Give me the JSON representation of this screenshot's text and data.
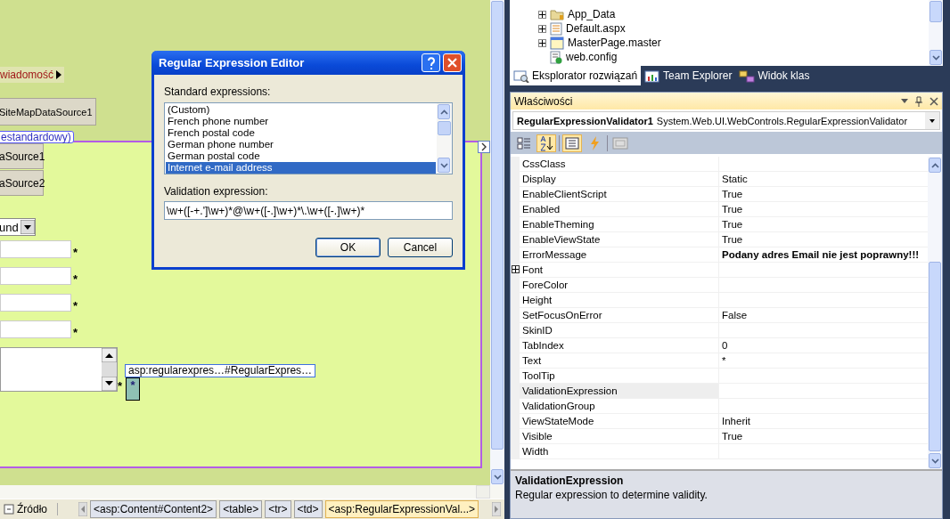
{
  "designer": {
    "menu_label": "wiadomość",
    "top_datasource": "SiteMapDataSource1",
    "content_tag": "estandardowy)",
    "datasources": [
      "aSource1",
      "aSource2"
    ],
    "dropdown_value": "und",
    "field_rows": [
      {
        "required_mark": "*"
      },
      {
        "required_mark": "*"
      },
      {
        "required_mark": "*"
      },
      {
        "required_mark": "*"
      }
    ],
    "textarea_mark": "*",
    "validator_text": "*",
    "smart_tag": "asp:regularexpres…#RegularExpres…"
  },
  "dialog": {
    "title": "Regular Expression Editor",
    "standard_label": "Standard expressions:",
    "options": [
      {
        "label": "(Custom)",
        "selected": false
      },
      {
        "label": "French phone number",
        "selected": false
      },
      {
        "label": "French postal code",
        "selected": false
      },
      {
        "label": "German phone number",
        "selected": false
      },
      {
        "label": "German postal code",
        "selected": false
      },
      {
        "label": "Internet e-mail address",
        "selected": true
      }
    ],
    "expression_label": "Validation expression:",
    "expression": "\\w+([-+.']\\w+)*@\\w+([-.]\\w+)*\\.\\w+([-.]\\w+)*",
    "buttons": [
      "OK",
      "Cancel"
    ]
  },
  "solution_tree": [
    {
      "label": "App_Data",
      "kind": "folder",
      "expandable": true
    },
    {
      "label": "Default.aspx",
      "kind": "page",
      "expandable": true
    },
    {
      "label": "MasterPage.master",
      "kind": "master",
      "expandable": true
    },
    {
      "label": "web.config",
      "kind": "config",
      "expandable": false
    }
  ],
  "tabs": [
    {
      "label": "Eksplorator rozwiązań",
      "selected": true
    },
    {
      "label": "Team Explorer",
      "selected": false
    },
    {
      "label": "Widok klas",
      "selected": false
    }
  ],
  "properties": {
    "title": "Właściwości",
    "object_name": "RegularExpressionValidator1",
    "object_type": "System.Web.UI.WebControls.RegularExpressionValidator",
    "rows": [
      {
        "name": "CssClass",
        "value": "",
        "selected": false,
        "expandable": false
      },
      {
        "name": "Display",
        "value": "Static",
        "selected": false,
        "expandable": false,
        "bold": false
      },
      {
        "name": "EnableClientScript",
        "value": "True",
        "selected": false,
        "expandable": false,
        "bold": false
      },
      {
        "name": "Enabled",
        "value": "True",
        "selected": false,
        "expandable": false,
        "bold": false
      },
      {
        "name": "EnableTheming",
        "value": "True",
        "selected": false,
        "expandable": false,
        "bold": false
      },
      {
        "name": "EnableViewState",
        "value": "True",
        "selected": false,
        "expandable": false,
        "bold": false
      },
      {
        "name": "ErrorMessage",
        "value": "Podany adres Email nie jest poprawny!!!",
        "selected": false,
        "expandable": false,
        "bold": true
      },
      {
        "name": "Font",
        "value": "",
        "selected": false,
        "expandable": true,
        "bold": false
      },
      {
        "name": "ForeColor",
        "value": "",
        "selected": false,
        "expandable": false
      },
      {
        "name": "Height",
        "value": "",
        "selected": false,
        "expandable": false
      },
      {
        "name": "SetFocusOnError",
        "value": "False",
        "selected": false,
        "expandable": false,
        "bold": false
      },
      {
        "name": "SkinID",
        "value": "",
        "selected": false,
        "expandable": false
      },
      {
        "name": "TabIndex",
        "value": "0",
        "selected": false,
        "expandable": false,
        "bold": false
      },
      {
        "name": "Text",
        "value": "*",
        "selected": false,
        "expandable": false,
        "bold": false
      },
      {
        "name": "ToolTip",
        "value": "",
        "selected": false,
        "expandable": false
      },
      {
        "name": "ValidationExpression",
        "value": "",
        "selected": true,
        "expandable": false,
        "bold": false
      },
      {
        "name": "ValidationGroup",
        "value": "",
        "selected": false,
        "expandable": false
      },
      {
        "name": "ViewStateMode",
        "value": "Inherit",
        "selected": false,
        "expandable": false,
        "bold": false
      },
      {
        "name": "Visible",
        "value": "True",
        "selected": false,
        "expandable": false,
        "bold": false
      },
      {
        "name": "Width",
        "value": "",
        "selected": false,
        "expandable": false
      }
    ],
    "description_title": "ValidationExpression",
    "description": "Regular expression to determine validity."
  },
  "status_bar": {
    "view_label": "Źródło",
    "tags": [
      {
        "label": "<asp:Content#Content2>",
        "selected": false
      },
      {
        "label": "<table>",
        "selected": false
      },
      {
        "label": "<tr>",
        "selected": false
      },
      {
        "label": "<td>",
        "selected": false
      },
      {
        "label": "<asp:RegularExpressionVal...>",
        "selected": true
      }
    ]
  }
}
